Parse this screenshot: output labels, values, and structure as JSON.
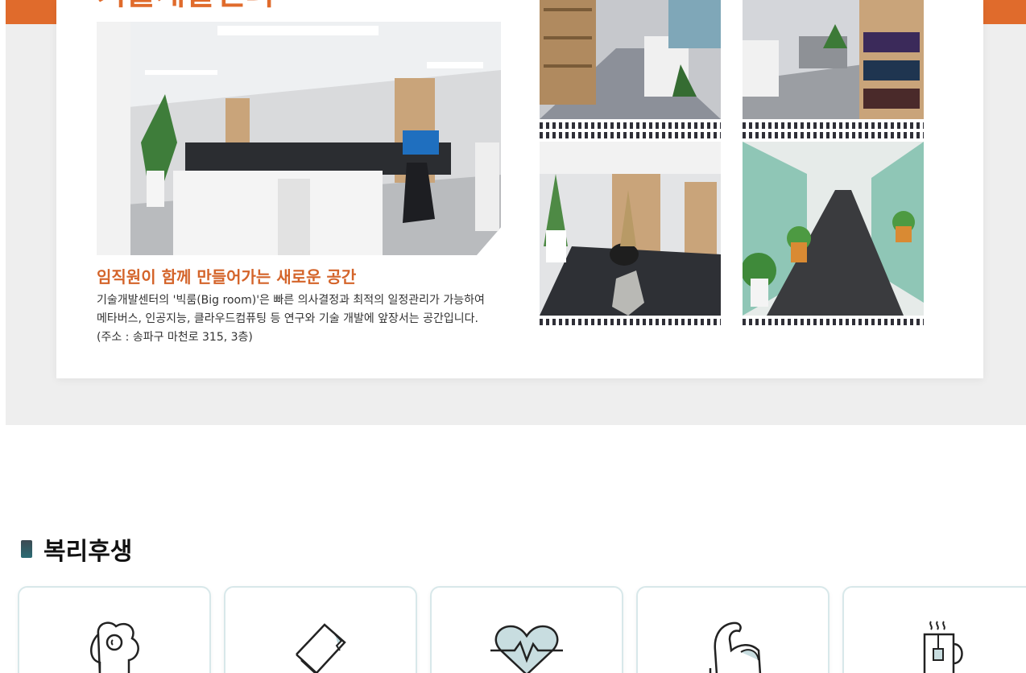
{
  "header": {
    "title": "기술개발센터",
    "accent_color": "#e06b2c"
  },
  "feature": {
    "subtitle": "임직원이 함께 만들어가는 새로운 공간",
    "description_lines": [
      "기술개발센터의 '빅룸(Big room)'은 빠른 의사결정과 최적의 일정관리가 가능하여",
      "메타버스, 인공지능, 클라우드컴퓨팅 등 연구와 기술 개발에 앞장서는 공간입니다.",
      "(주소 : 송파구 마천로 315, 3층)"
    ],
    "photos": [
      "office-bookshelf-corridor-photo",
      "office-desks-bookshelf-photo",
      "office-lobby-map-photo",
      "office-glass-hallway-photo"
    ]
  },
  "welfare": {
    "title": "복리후생",
    "cards": [
      {
        "icon": "fried-egg-icon"
      },
      {
        "icon": "book-icon"
      },
      {
        "icon": "heartbeat-icon"
      },
      {
        "icon": "muscle-arm-icon"
      },
      {
        "icon": "coffee-mug-icon"
      }
    ]
  }
}
